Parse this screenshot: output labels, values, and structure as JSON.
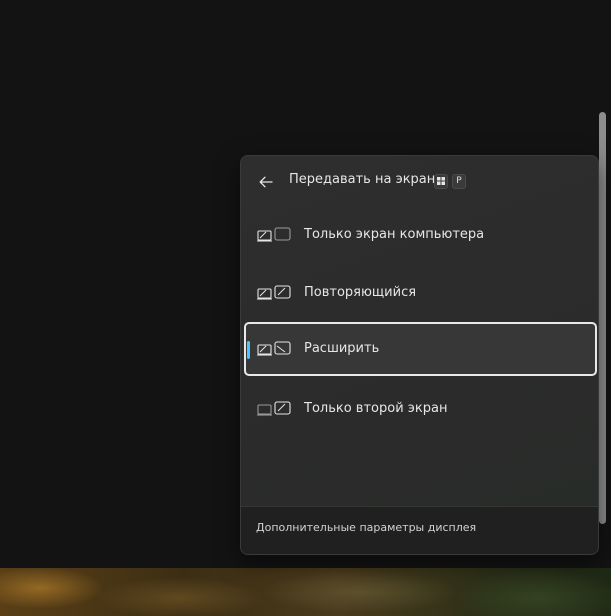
{
  "flyout": {
    "title": "Передавать на экран",
    "back_icon": "arrow-left-icon",
    "shortcut": {
      "win_key_icon": "windows-logo-icon",
      "key": "P"
    },
    "options": [
      {
        "label": "Только экран компьютера",
        "icon": "pc-screen-only-icon",
        "selected": false
      },
      {
        "label": "Повторяющийся",
        "icon": "duplicate-icon",
        "selected": false
      },
      {
        "label": "Расширить",
        "icon": "extend-icon",
        "selected": true
      },
      {
        "label": "Только второй экран",
        "icon": "second-screen-only-icon",
        "selected": false
      }
    ],
    "footer_link": "Дополнительные параметры дисплея",
    "accent_color": "#4cc2ff"
  }
}
